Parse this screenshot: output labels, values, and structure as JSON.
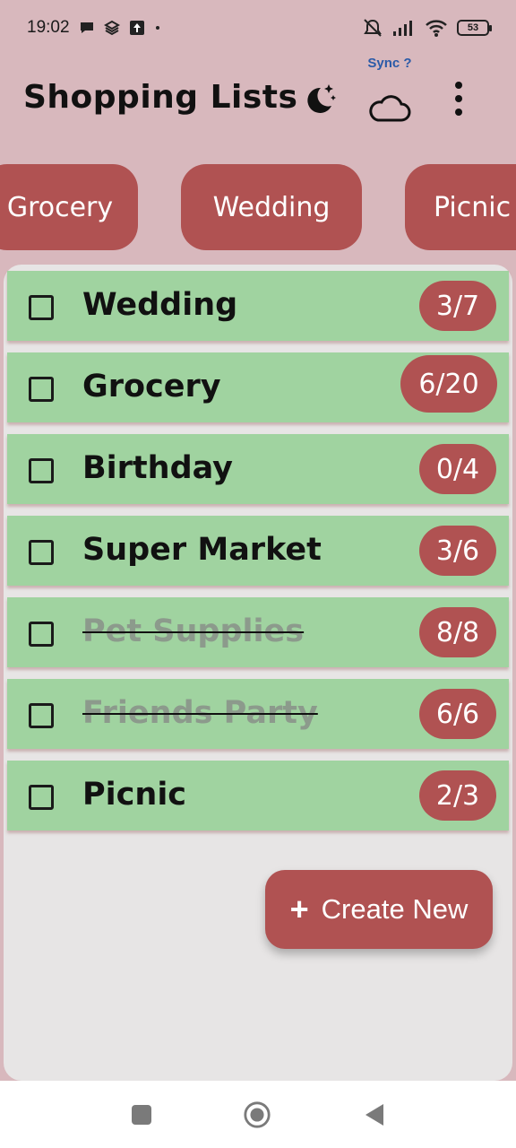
{
  "status_bar": {
    "time": "19:02",
    "battery": "53",
    "icons": [
      "chat-bubble-icon",
      "layers-icon",
      "upload-icon",
      "dot-icon",
      "muted-bell-icon",
      "signal-icon",
      "wifi-icon",
      "battery-icon"
    ]
  },
  "app_bar": {
    "title": "Shopping Lists",
    "sync_label": "Sync ?",
    "icons": [
      "moon-stars-icon",
      "cloud-icon",
      "more-vert-icon"
    ]
  },
  "chips": [
    "Grocery",
    "Wedding",
    "Picnic"
  ],
  "lists": [
    {
      "name": "Wedding",
      "count": "3/7",
      "done": false
    },
    {
      "name": "Grocery",
      "count": "6/20",
      "done": false
    },
    {
      "name": "Birthday",
      "count": "0/4",
      "done": false
    },
    {
      "name": "Super Market",
      "count": "3/6",
      "done": false
    },
    {
      "name": "Pet Supplies",
      "count": "8/8",
      "done": true
    },
    {
      "name": "Friends Party",
      "count": "6/6",
      "done": true
    },
    {
      "name": "Picnic",
      "count": "2/3",
      "done": false
    }
  ],
  "fab": {
    "label": "Create New",
    "icon": "plus-icon"
  },
  "nav_bar": {
    "icons": [
      "recents-square-icon",
      "home-circle-icon",
      "back-triangle-icon"
    ]
  },
  "colors": {
    "background": "#d8b8bd",
    "accent": "#b05252",
    "item": "#a0d3a0",
    "panel": "#e7e5e5"
  }
}
